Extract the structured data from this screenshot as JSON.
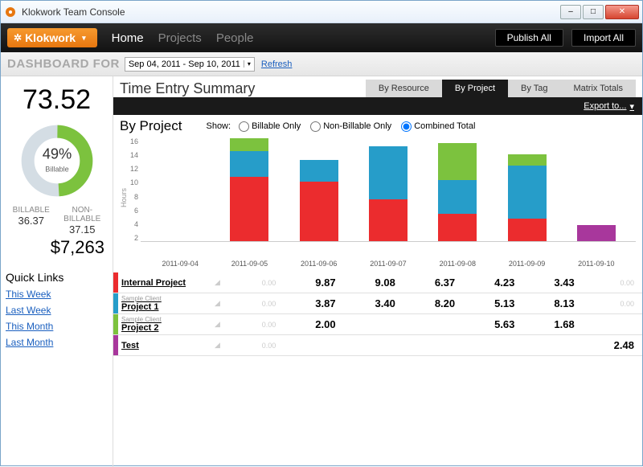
{
  "window": {
    "title": "Klokwork Team Console"
  },
  "brand": {
    "name": "Klokwork"
  },
  "nav": {
    "items": [
      {
        "label": "Home",
        "active": true
      },
      {
        "label": "Projects",
        "active": false
      },
      {
        "label": "People",
        "active": false
      }
    ],
    "publish": "Publish All",
    "import": "Import All"
  },
  "dashboard": {
    "label": "DASHBOARD FOR",
    "range": "Sep 04, 2011 - Sep 10, 2011",
    "refresh": "Refresh"
  },
  "kpi": {
    "total_hours": "73.52",
    "billable_pct": "49%",
    "billable_label": "Billable",
    "billable_caption": "BILLABLE",
    "nonbillable_caption": "NON-BILLABLE",
    "billable_hours": "36.37",
    "nonbillable_hours": "37.15",
    "revenue": "$7,263"
  },
  "quicklinks": {
    "title": "Quick Links",
    "items": [
      "This Week",
      "Last Week",
      "This Month",
      "Last Month"
    ]
  },
  "section": {
    "title": "Time Entry Summary"
  },
  "tabs": [
    "By Resource",
    "By Project",
    "By Tag",
    "Matrix Totals"
  ],
  "tabs_active_index": 1,
  "export_label": "Export to...",
  "chart_header": {
    "title": "By Project",
    "show_label": "Show:",
    "options": [
      "Billable Only",
      "Non-Billable Only",
      "Combined Total"
    ],
    "selected_index": 2
  },
  "chart_data": {
    "type": "bar-stacked",
    "ylabel": "Hours",
    "ylim": [
      0,
      16
    ],
    "yticks": [
      16,
      14,
      12,
      10,
      8,
      6,
      4,
      2
    ],
    "categories": [
      "2011-09-04",
      "2011-09-05",
      "2011-09-06",
      "2011-09-07",
      "2011-09-08",
      "2011-09-09",
      "2011-09-10"
    ],
    "series": [
      {
        "name": "Internal Project",
        "color": "red",
        "values": [
          0,
          9.87,
          9.08,
          6.37,
          4.23,
          3.43,
          0
        ]
      },
      {
        "name": "Project 1",
        "color": "blue",
        "values": [
          0,
          3.87,
          3.4,
          8.2,
          5.13,
          8.13,
          0
        ]
      },
      {
        "name": "Project 2",
        "color": "green",
        "values": [
          0,
          2.0,
          0.0,
          0.0,
          5.63,
          1.68,
          0
        ]
      },
      {
        "name": "Test",
        "color": "purple",
        "values": [
          0,
          0.0,
          0.0,
          0.0,
          0.0,
          0.0,
          2.48
        ]
      }
    ]
  },
  "table": {
    "rows": [
      {
        "swatch": "#eb2c2e",
        "client": "",
        "project": "Internal Project",
        "cells": [
          "0.00",
          "9.87",
          "9.08",
          "6.37",
          "4.23",
          "3.43",
          "0.00"
        ]
      },
      {
        "swatch": "#269dc9",
        "client": "Sample Client",
        "project": "Project 1",
        "cells": [
          "0.00",
          "3.87",
          "3.40",
          "8.20",
          "5.13",
          "8.13",
          "0.00"
        ]
      },
      {
        "swatch": "#7cc23e",
        "client": "Sample Client",
        "project": "Project 2",
        "cells": [
          "0.00",
          "2.00",
          "",
          "",
          "5.63",
          "1.68",
          ""
        ]
      },
      {
        "swatch": "#a8379c",
        "client": "",
        "project": "Test",
        "cells": [
          "0.00",
          "",
          "",
          "",
          "",
          "",
          "2.48"
        ]
      }
    ]
  }
}
